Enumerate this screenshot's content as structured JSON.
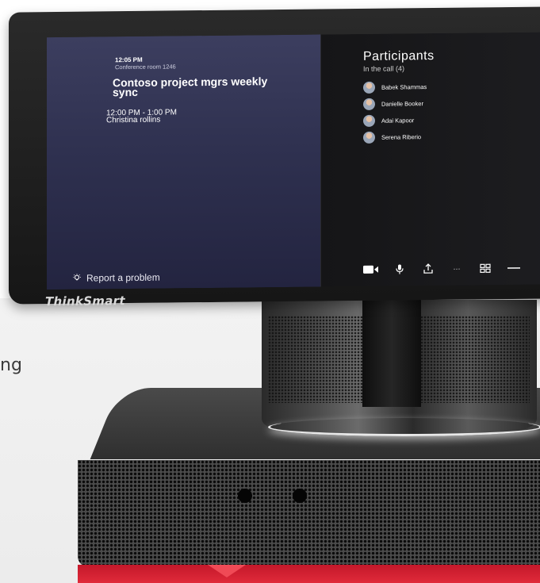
{
  "background_side_text": "ng",
  "meeting": {
    "time": "12:05 PM",
    "room": "Conference room 1246",
    "title": "Contoso project mgrs weekly sync",
    "time_range": "12:00 PM - 1:00 PM",
    "organizer": "Christina rollins"
  },
  "report_label": "Report a problem",
  "participants": {
    "heading": "Participants",
    "subheading": "In the call (4)",
    "list": [
      {
        "name": "Babek Shammas"
      },
      {
        "name": "Danielle Booker"
      },
      {
        "name": "Adai Kapoor"
      },
      {
        "name": "Serena Riberio"
      }
    ]
  },
  "toolbar": {
    "more_label": "···"
  },
  "brand": "ThinkSmart",
  "icons": [
    "lightbulb-icon",
    "camera-icon",
    "microphone-icon",
    "share-icon",
    "more-icon",
    "layout-grid-icon",
    "minimize-icon"
  ]
}
